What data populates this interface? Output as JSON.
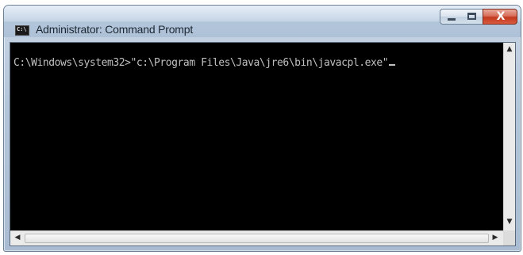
{
  "window": {
    "title": "Administrator: Command Prompt",
    "icon": "console-icon",
    "icon_caption": "C:\\",
    "controls": {
      "minimize_icon": "minimize-icon",
      "maximize_icon": "maximize-icon",
      "close_icon": "close-icon",
      "close_glyph": "X"
    }
  },
  "console": {
    "prompt": "C:\\Windows\\system32>",
    "command": "\"c:\\Program Files\\Java\\jre6\\bin\\javacpl.exe\"",
    "text_color": "#c0c0c0",
    "background_color": "#000000"
  },
  "scrollbars": {
    "up_arrow": "▲",
    "down_arrow": "▼",
    "left_arrow": "◀",
    "right_arrow": "▶"
  },
  "colors": {
    "close_button": "#c2391f",
    "titlebar": "#c4d4e5"
  }
}
